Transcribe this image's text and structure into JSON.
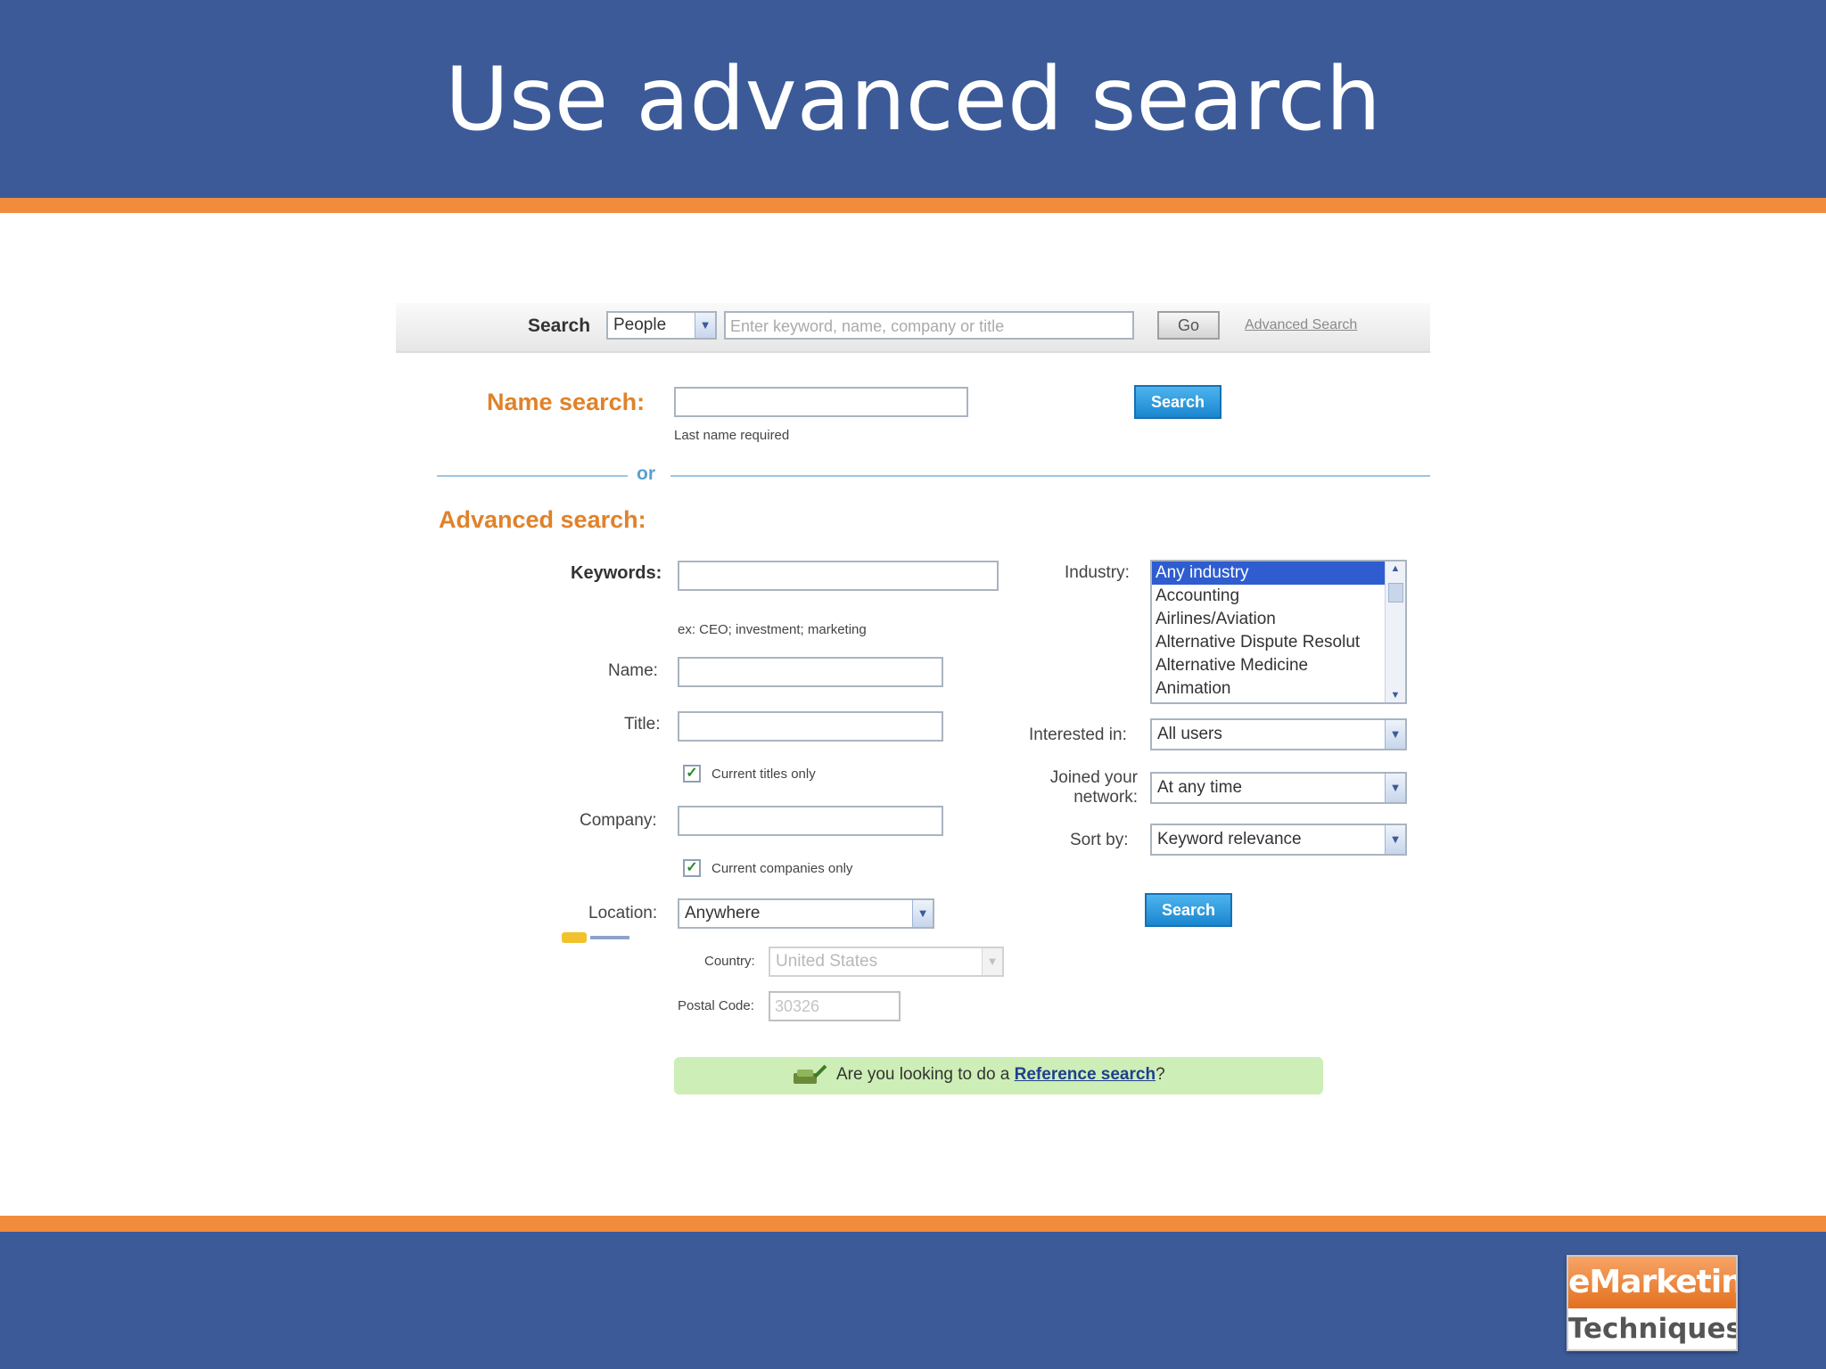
{
  "slide": {
    "title": "Use advanced search",
    "logo": {
      "line1": "eMarketing",
      "line2": "Techniques"
    }
  },
  "colors": {
    "header_bg": "#3c5a97",
    "stripe": "#f08c3c",
    "accent_orange": "#e0822a",
    "button_blue": "#1a86cf"
  },
  "topbar": {
    "search_label": "Search",
    "scope_select": "People",
    "search_placeholder": "Enter keyword, name, company or title",
    "go_label": "Go",
    "advanced_link": "Advanced Search"
  },
  "name_search": {
    "heading": "Name search:",
    "hint": "Last name required",
    "button": "Search"
  },
  "divider": {
    "or_label": "or"
  },
  "advanced": {
    "heading": "Advanced search:",
    "keywords_label": "Keywords:",
    "keywords_hint": "ex: CEO; investment; marketing",
    "name_label": "Name:",
    "title_label": "Title:",
    "current_titles_label": "Current titles only",
    "company_label": "Company:",
    "current_companies_label": "Current companies only",
    "location_label": "Location:",
    "location_value": "Anywhere",
    "country_label": "Country:",
    "country_value": "United States",
    "postal_label": "Postal Code:",
    "postal_value": "30326",
    "industry_label": "Industry:",
    "industries": [
      "Any industry",
      "Accounting",
      "Airlines/Aviation",
      "Alternative Dispute Resolut",
      "Alternative Medicine",
      "Animation"
    ],
    "interested_label": "Interested in:",
    "interested_value": "All users",
    "joined_label_1": "Joined your",
    "joined_label_2": "network:",
    "joined_value": "At any time",
    "sort_label": "Sort by:",
    "sort_value": "Keyword relevance",
    "button": "Search"
  },
  "reference_banner": {
    "prefix": "Are you looking to do a ",
    "link": "Reference search",
    "suffix": "?"
  }
}
